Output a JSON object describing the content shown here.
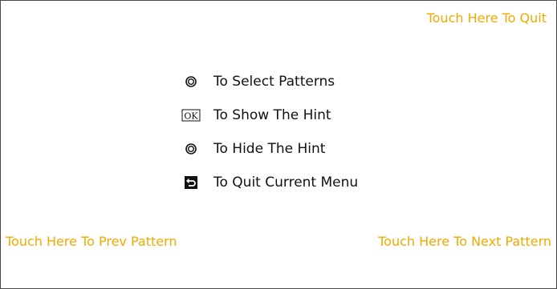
{
  "touch_zones": {
    "quit": "Touch Here To Quit",
    "prev": "Touch Here To Prev Pattern",
    "next": "Touch Here To Next Pattern"
  },
  "legend": {
    "items": [
      {
        "icon": "ring-button-icon",
        "text": "To Select Patterns"
      },
      {
        "icon": "ok-button-icon",
        "icon_text": "OK",
        "text": "To Show The Hint"
      },
      {
        "icon": "ring-button-icon",
        "text": "To Hide The Hint"
      },
      {
        "icon": "back-arrow-icon",
        "text": "To Quit Current Menu"
      }
    ]
  },
  "colors": {
    "accent": "#f2a900",
    "text": "#111111",
    "border": "#4a4a4a",
    "background": "#ffffff"
  }
}
